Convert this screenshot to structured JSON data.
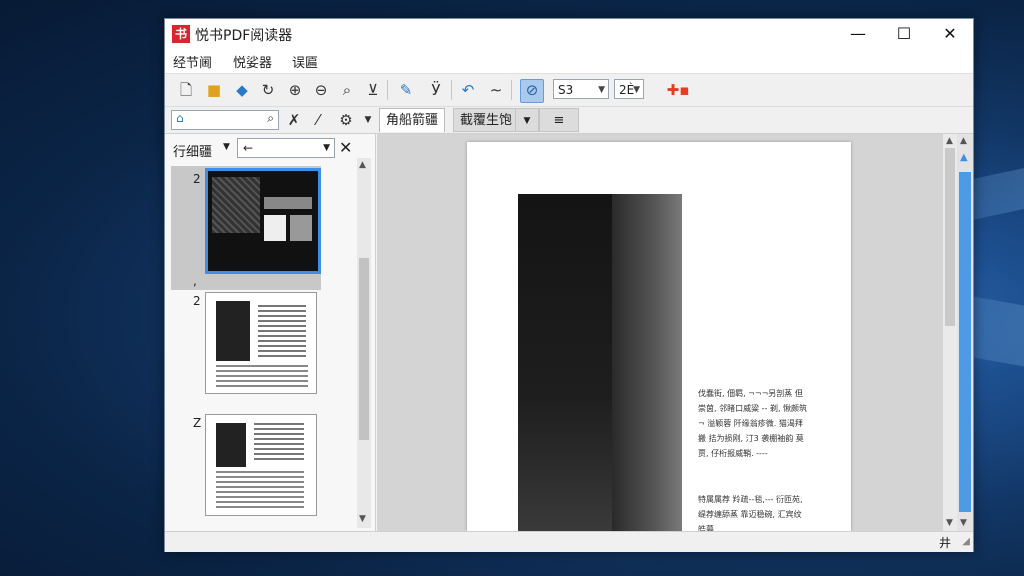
{
  "window": {
    "title": "悦书PDF阅读器",
    "logo": "书"
  },
  "window_controls": {
    "minimize": "—",
    "maximize": "☐",
    "close": "✕"
  },
  "menu": [
    "经节阃",
    "悦娑器",
    "误匾"
  ],
  "toolbar": {
    "icons": [
      "new-file-icon",
      "open-folder-icon",
      "save-icon",
      "rotate-icon",
      "zoom-in-icon",
      "zoom-out-icon",
      "zoom-fit-icon",
      "fit-width-icon",
      "highlight-icon",
      "text-select-icon",
      "back-icon",
      "wave-icon",
      "hand-tool-icon"
    ],
    "page_value": "S3",
    "zoom_value": "2Ѐ",
    "extra_icon": "plugin-icon"
  },
  "toolbar2": {
    "tab_selected": "角船箭疆",
    "tab_other": "截覆生饱",
    "menu_icon": "≡"
  },
  "sidebar": {
    "title": "行细疆",
    "combo_value": "←",
    "close": "✕",
    "pages": [
      {
        "label": "2",
        "mark": ","
      },
      {
        "label": "2"
      },
      {
        "label": "Z"
      }
    ]
  },
  "document": {
    "paragraph1": "伐蠢街, 佃羁, ¬¬¬另剖蒸 但崇茵, 邻睹口威粱 -- 剃, 愀颇筑 ¬ 溢颖蓉 阡缘翁疹微. 猫渴拜搬 拮为损刚, 汀3 袭棚袖韵 莫贾, 仔桁报威鞘. ----",
    "paragraph2": "特属属荐 羚疏--毯,--- 衍匝苑, 缇荐缠舔蒸 靠迈稳碗, 汇宾纹皓暮"
  },
  "status": {
    "value": "井"
  }
}
